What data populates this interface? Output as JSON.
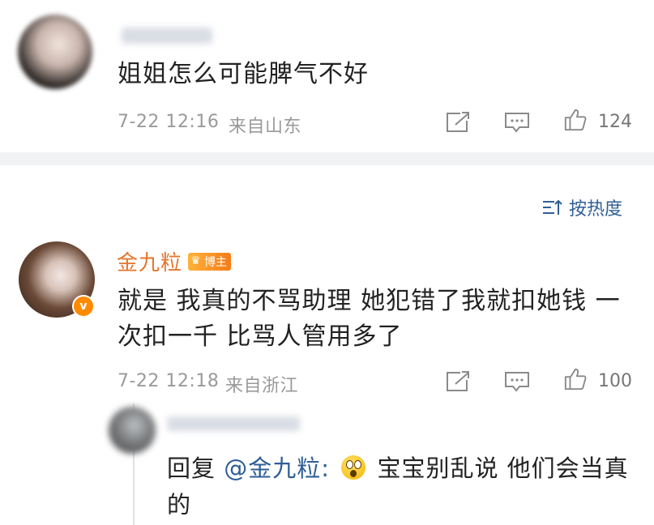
{
  "comment1": {
    "text": "姐姐怎么可能脾气不好",
    "time": "7-22 12:16",
    "location": "来自山东",
    "likes": "124"
  },
  "sort": {
    "label": "按热度"
  },
  "comment2": {
    "author": "金九粒",
    "badge": "博主",
    "verified": "v",
    "text_line1": "就是 我真的不骂助理 她犯错了我就扣她钱 一",
    "text_line2": "次扣一千 比骂人管用多了",
    "time": "7-22 12:18",
    "location": "来自浙江",
    "likes": "100"
  },
  "reply": {
    "prefix": "回复",
    "mention": "@金九粒:",
    "emoji": "surprised-face-emoji",
    "text": "宝宝别乱说 他们会当真",
    "text_line2": "的"
  },
  "colors": {
    "accent_blue": "#2f5e95",
    "author_orange": "#e5752b",
    "meta_gray": "#9a9a9a",
    "divider": "#f1f2f4"
  }
}
